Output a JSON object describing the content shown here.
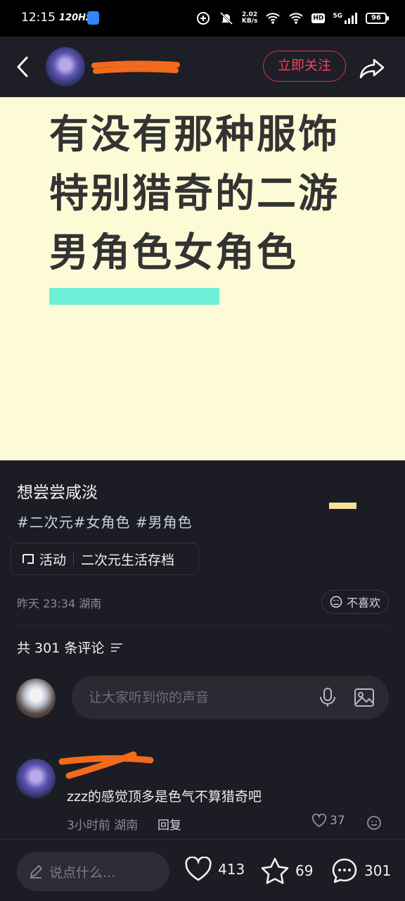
{
  "status_bar": {
    "time": "12:15",
    "refresh": "120Hz",
    "net_speed": "2.02",
    "net_unit": "KB/s",
    "hd": "HD",
    "network": "5G",
    "battery": "96"
  },
  "header": {
    "follow_label": "立即关注"
  },
  "cover": {
    "line1": "有没有那种服饰",
    "line2": "特别猎奇的二游",
    "line3": "男角色女角色"
  },
  "post": {
    "title": "想尝尝咸淡",
    "tags": "#二次元#女角色 #男角色",
    "activity_label": "活动",
    "activity_name": "二次元生活存档",
    "time": "昨天 23:34",
    "location": "湖南",
    "dislike_label": "不喜欢"
  },
  "comments": {
    "count_label": "共 301 条评论",
    "input_placeholder": "让大家听到你的声音",
    "items": [
      {
        "text": "zzz的感觉顶多是色气不算猎奇吧",
        "time": "3小时前",
        "location": "湖南",
        "reply_label": "回复",
        "likes": "37"
      }
    ]
  },
  "bottom_bar": {
    "say_placeholder": "说点什么...",
    "likes": "413",
    "stars": "69",
    "comments": "301"
  },
  "colors": {
    "cover_bg": "#fdfbd6",
    "highlight": "#6ef0d8",
    "follow": "#ff3d5a",
    "background": "#1c1c24"
  }
}
